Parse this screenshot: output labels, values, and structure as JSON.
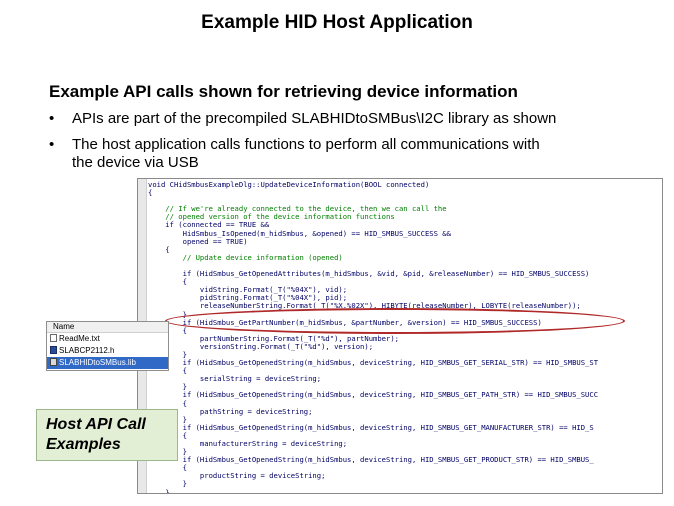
{
  "slide": {
    "title": "Example HID Host Application",
    "subtitle": "Example API calls shown for retrieving device information",
    "bullets": [
      "APIs are part of the precompiled SLABHIDtoSMBus\\I2C library  as shown",
      "The host application calls functions to perform all communications with",
      "the device via USB"
    ],
    "bullet_symbol": "•"
  },
  "code": {
    "lines": [
      "void CHidSmbusExampleDlg::UpdateDeviceInformation(BOOL connected)",
      "{",
      "",
      "    // If we're already connected to the device, then we can call the",
      "    // opened version of the device information functions",
      "    if (connected == TRUE &&",
      "        HidSmbus_IsOpened(m_hidSmbus, &opened) == HID_SMBUS_SUCCESS &&",
      "        opened == TRUE)",
      "    {",
      "        // Update device information (opened)",
      "",
      "        if (HidSmbus_GetOpenedAttributes(m_hidSmbus, &vid, &pid, &releaseNumber) == HID_SMBUS_SUCCESS)",
      "        {",
      "            vidString.Format(_T(\"%04X\"), vid);",
      "            pidString.Format(_T(\"%04X\"), pid);",
      "            releaseNumberString.Format(_T(\"%X.%02X\"), HIBYTE(releaseNumber), LOBYTE(releaseNumber));",
      "        }",
      "        if (HidSmbus_GetPartNumber(m_hidSmbus, &partNumber, &version) == HID_SMBUS_SUCCESS)",
      "        {",
      "            partNumberString.Format(_T(\"%d\"), partNumber);",
      "            versionString.Format(_T(\"%d\"), version);",
      "        }",
      "        if (HidSmbus_GetOpenedString(m_hidSmbus, deviceString, HID_SMBUS_GET_SERIAL_STR) == HID_SMBUS_ST",
      "        {",
      "            serialString = deviceString;",
      "        }",
      "        if (HidSmbus_GetOpenedString(m_hidSmbus, deviceString, HID_SMBUS_GET_PATH_STR) == HID_SMBUS_SUCC",
      "        {",
      "            pathString = deviceString;",
      "        }",
      "        if (HidSmbus_GetOpenedString(m_hidSmbus, deviceString, HID_SMBUS_GET_MANUFACTURER_STR) == HID_S",
      "        {",
      "            manufacturerString = deviceString;",
      "        }",
      "        if (HidSmbus_GetOpenedString(m_hidSmbus, deviceString, HID_SMBUS_GET_PRODUCT_STR) == HID_SMBUS_",
      "        {",
      "            productString = deviceString;",
      "        }",
      "    }"
    ]
  },
  "explorer": {
    "column_header": "Name",
    "files": [
      {
        "name": "ReadMe.txt",
        "icon": "text-file-icon",
        "selected": false
      },
      {
        "name": "SLABCP2112.h",
        "icon": "header-file-icon",
        "selected": false
      },
      {
        "name": "SLABHIDtoSMBus.lib",
        "icon": "library-file-icon",
        "selected": true
      }
    ]
  },
  "callout": {
    "line1": "Host API Call",
    "line2": "Examples"
  },
  "colors": {
    "highlight_oval": "#b02828",
    "callout_bg": "#e3efd5",
    "code_comment": "#008000",
    "code_text": "#000066",
    "selection": "#3169c6"
  }
}
